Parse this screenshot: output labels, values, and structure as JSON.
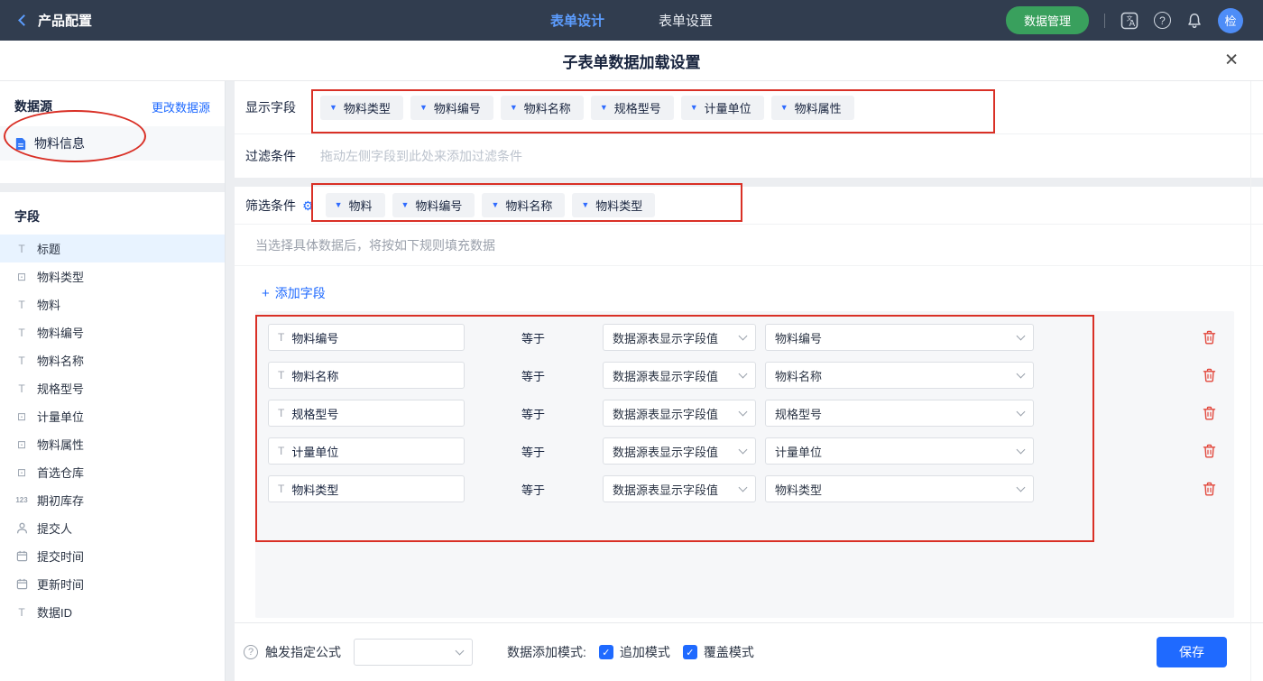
{
  "colors": {
    "accent": "#1f6aff",
    "topbar": "#313d4f",
    "green_button": "#39a05d",
    "annotation_red": "#d93026",
    "trash_red": "#e2483d"
  },
  "topbar": {
    "back_label": "产品配置",
    "tabs": [
      {
        "label": "表单设计"
      },
      {
        "label": "表单设置"
      }
    ],
    "data_manage_button": "数据管理",
    "avatar_text": "检"
  },
  "modal": {
    "title": "子表单数据加载设置"
  },
  "sidebar": {
    "datasource_title": "数据源",
    "change_link": "更改数据源",
    "datasource_name": "物料信息",
    "fields_title": "字段",
    "fields": [
      {
        "label": "标题",
        "type": "text"
      },
      {
        "label": "物料类型",
        "type": "select"
      },
      {
        "label": "物料",
        "type": "text"
      },
      {
        "label": "物料编号",
        "type": "text"
      },
      {
        "label": "物料名称",
        "type": "text"
      },
      {
        "label": "规格型号",
        "type": "text"
      },
      {
        "label": "计量单位",
        "type": "select"
      },
      {
        "label": "物料属性",
        "type": "select"
      },
      {
        "label": "首选仓库",
        "type": "select"
      },
      {
        "label": "期初库存",
        "type": "number"
      },
      {
        "label": "提交人",
        "type": "person"
      },
      {
        "label": "提交时间",
        "type": "date"
      },
      {
        "label": "更新时间",
        "type": "date"
      },
      {
        "label": "数据ID",
        "type": "text"
      }
    ]
  },
  "main": {
    "display_fields": {
      "label": "显示字段",
      "chips": [
        "物料类型",
        "物料编号",
        "物料名称",
        "规格型号",
        "计量单位",
        "物料属性"
      ]
    },
    "filter": {
      "label": "过滤条件",
      "placeholder": "拖动左侧字段到此处来添加过滤条件"
    },
    "screen": {
      "label": "筛选条件",
      "chips": [
        "物料",
        "物料编号",
        "物料名称",
        "物料类型"
      ]
    },
    "hint": "当选择具体数据后，将按如下规则填充数据",
    "add_field_label": "添加字段",
    "rules": {
      "operator": "等于",
      "source_value": "数据源表显示字段值",
      "rows": [
        {
          "field": "物料编号",
          "target": "物料编号"
        },
        {
          "field": "物料名称",
          "target": "物料名称"
        },
        {
          "field": "规格型号",
          "target": "规格型号"
        },
        {
          "field": "计量单位",
          "target": "计量单位"
        },
        {
          "field": "物料类型",
          "target": "物料类型"
        }
      ]
    }
  },
  "footer": {
    "formula_label": "触发指定公式",
    "mode_label": "数据添加模式:",
    "modes": [
      {
        "label": "追加模式",
        "checked": true
      },
      {
        "label": "覆盖模式",
        "checked": true
      }
    ],
    "save_label": "保存"
  }
}
